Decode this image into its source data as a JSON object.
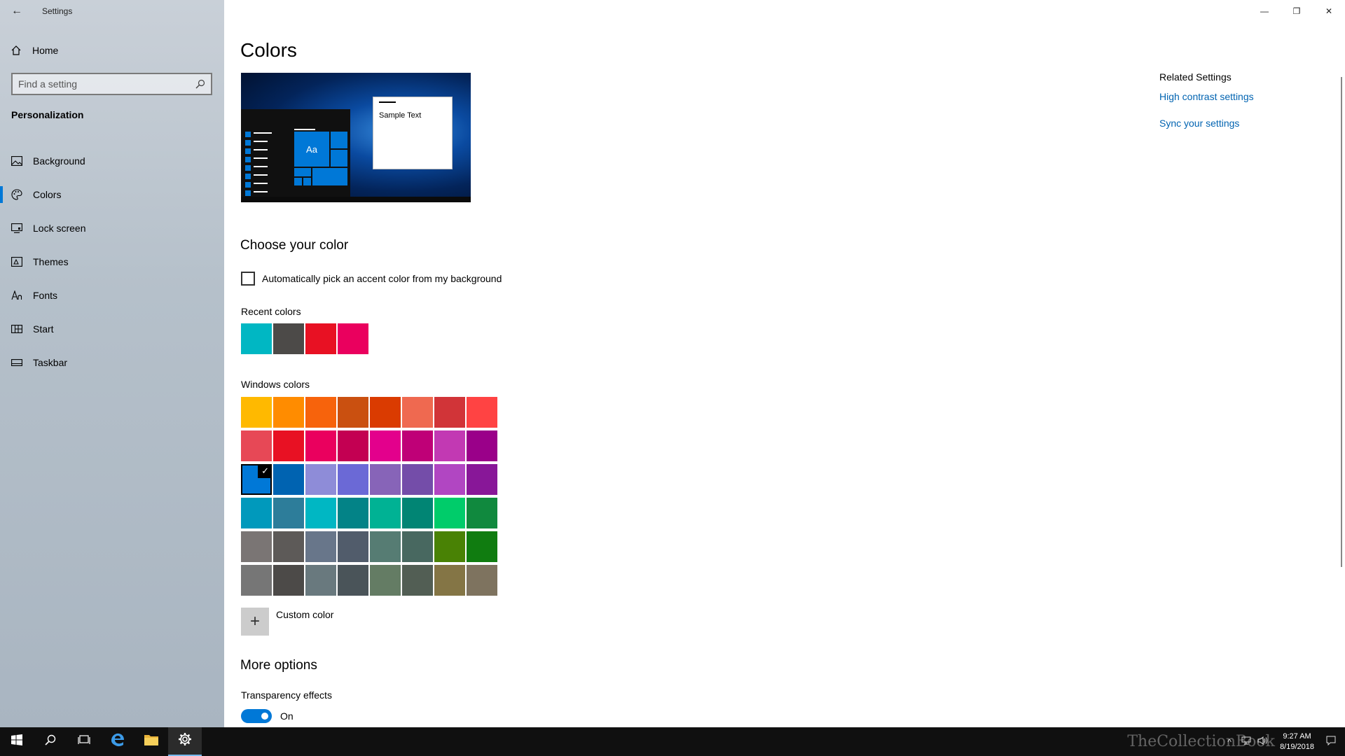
{
  "window": {
    "title": "Settings",
    "back_glyph": "←",
    "minimize_glyph": "—",
    "maximize_glyph": "❐",
    "close_glyph": "✕"
  },
  "sidebar": {
    "home_label": "Home",
    "search_placeholder": "Find a setting",
    "section_title": "Personalization",
    "items": [
      {
        "label": "Background",
        "icon": "picture-icon"
      },
      {
        "label": "Colors",
        "icon": "palette-icon",
        "selected": true
      },
      {
        "label": "Lock screen",
        "icon": "lock-screen-icon"
      },
      {
        "label": "Themes",
        "icon": "themes-icon"
      },
      {
        "label": "Fonts",
        "icon": "fonts-icon"
      },
      {
        "label": "Start",
        "icon": "start-icon"
      },
      {
        "label": "Taskbar",
        "icon": "taskbar-icon"
      }
    ]
  },
  "main": {
    "title": "Colors",
    "preview": {
      "sample_text": "Sample Text",
      "tile_text": "Aa"
    },
    "choose_color_heading": "Choose your color",
    "auto_pick_label": "Automatically pick an accent color from my background",
    "auto_pick_checked": false,
    "recent_colors_label": "Recent colors",
    "recent_colors": [
      "#00b7c3",
      "#4c4a48",
      "#e81123",
      "#ea005e"
    ],
    "windows_colors_label": "Windows colors",
    "windows_colors": [
      [
        "#ffb900",
        "#ff8c00",
        "#f7630c",
        "#ca5010",
        "#da3b01",
        "#ef6950",
        "#d13438",
        "#ff4343"
      ],
      [
        "#e74856",
        "#e81123",
        "#ea005e",
        "#c30052",
        "#e3008c",
        "#bf0077",
        "#c239b3",
        "#9a0089"
      ],
      [
        "#0078d7",
        "#0063b1",
        "#8e8cd8",
        "#6b69d6",
        "#8764b8",
        "#744da9",
        "#b146c2",
        "#881798"
      ],
      [
        "#0099bc",
        "#2d7d9a",
        "#00b7c3",
        "#038387",
        "#00b294",
        "#018574",
        "#00cc6a",
        "#10893e"
      ],
      [
        "#7a7574",
        "#5d5a58",
        "#68768a",
        "#515c6b",
        "#567c73",
        "#486860",
        "#498205",
        "#107c10"
      ],
      [
        "#767676",
        "#4c4a48",
        "#69797e",
        "#4a5459",
        "#647c64",
        "#525e54",
        "#847545",
        "#7e735f"
      ]
    ],
    "selected_color": "#0078d7",
    "custom_color_label": "Custom color",
    "more_options_heading": "More options",
    "transparency_label": "Transparency effects",
    "transparency_state": "On"
  },
  "related": {
    "title": "Related Settings",
    "links": [
      "High contrast settings",
      "Sync your settings"
    ]
  },
  "taskbar": {
    "time": "9:27 AM",
    "date": "8/19/2018",
    "watermark": "TheCollectionBook"
  },
  "colors": {
    "accent": "#0078d7",
    "link": "#0063b1"
  }
}
